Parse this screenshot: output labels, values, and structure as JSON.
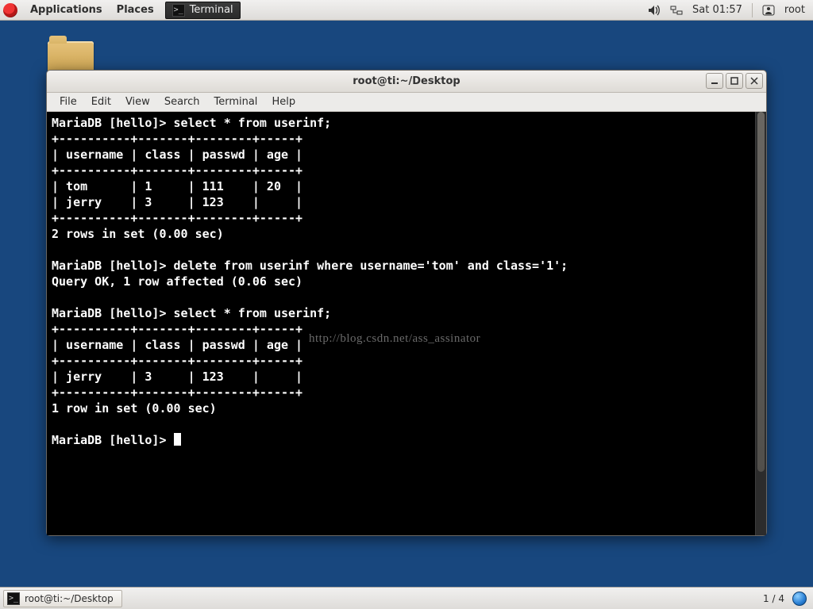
{
  "top_panel": {
    "applications": "Applications",
    "places": "Places",
    "task_terminal": "Terminal",
    "clock": "Sat 01:57",
    "user": "root"
  },
  "desktop": {
    "folder_name": "folder"
  },
  "window": {
    "title": "root@ti:~/Desktop",
    "menu": {
      "file": "File",
      "edit": "Edit",
      "view": "View",
      "search": "Search",
      "terminal": "Terminal",
      "help": "Help"
    }
  },
  "terminal": {
    "lines": [
      "MariaDB [hello]> select * from userinf;",
      "+----------+-------+--------+-----+",
      "| username | class | passwd | age |",
      "+----------+-------+--------+-----+",
      "| tom      | 1     | 111    | 20  |",
      "| jerry    | 3     | 123    |     |",
      "+----------+-------+--------+-----+",
      "2 rows in set (0.00 sec)",
      "",
      "MariaDB [hello]> delete from userinf where username='tom' and class='1';",
      "Query OK, 1 row affected (0.06 sec)",
      "",
      "MariaDB [hello]> select * from userinf;",
      "+----------+-------+--------+-----+",
      "| username | class | passwd | age |",
      "+----------+-------+--------+-----+",
      "| jerry    | 3     | 123    |     |",
      "+----------+-------+--------+-----+",
      "1 row in set (0.00 sec)",
      "",
      "MariaDB [hello]> "
    ],
    "prompt": "MariaDB [hello]>",
    "database": "hello",
    "queries": [
      {
        "sql": "select * from userinf;",
        "rows_msg": "2 rows in set (0.00 sec)"
      },
      {
        "sql": "delete from userinf where username='tom' and class='1';",
        "rows_msg": "Query OK, 1 row affected (0.06 sec)"
      },
      {
        "sql": "select * from userinf;",
        "rows_msg": "1 row in set (0.00 sec)"
      }
    ],
    "table1": {
      "columns": [
        "username",
        "class",
        "passwd",
        "age"
      ],
      "rows": [
        {
          "username": "tom",
          "class": "1",
          "passwd": "111",
          "age": "20"
        },
        {
          "username": "jerry",
          "class": "3",
          "passwd": "123",
          "age": ""
        }
      ]
    },
    "table2": {
      "columns": [
        "username",
        "class",
        "passwd",
        "age"
      ],
      "rows": [
        {
          "username": "jerry",
          "class": "3",
          "passwd": "123",
          "age": ""
        }
      ]
    },
    "watermark": "http://blog.csdn.net/ass_assinator"
  },
  "bottom_panel": {
    "task_label": "root@ti:~/Desktop",
    "workspace": "1 / 4"
  },
  "colors": {
    "desktop_bg": "#18477e",
    "terminal_bg": "#000000",
    "terminal_fg": "#ffffff"
  }
}
